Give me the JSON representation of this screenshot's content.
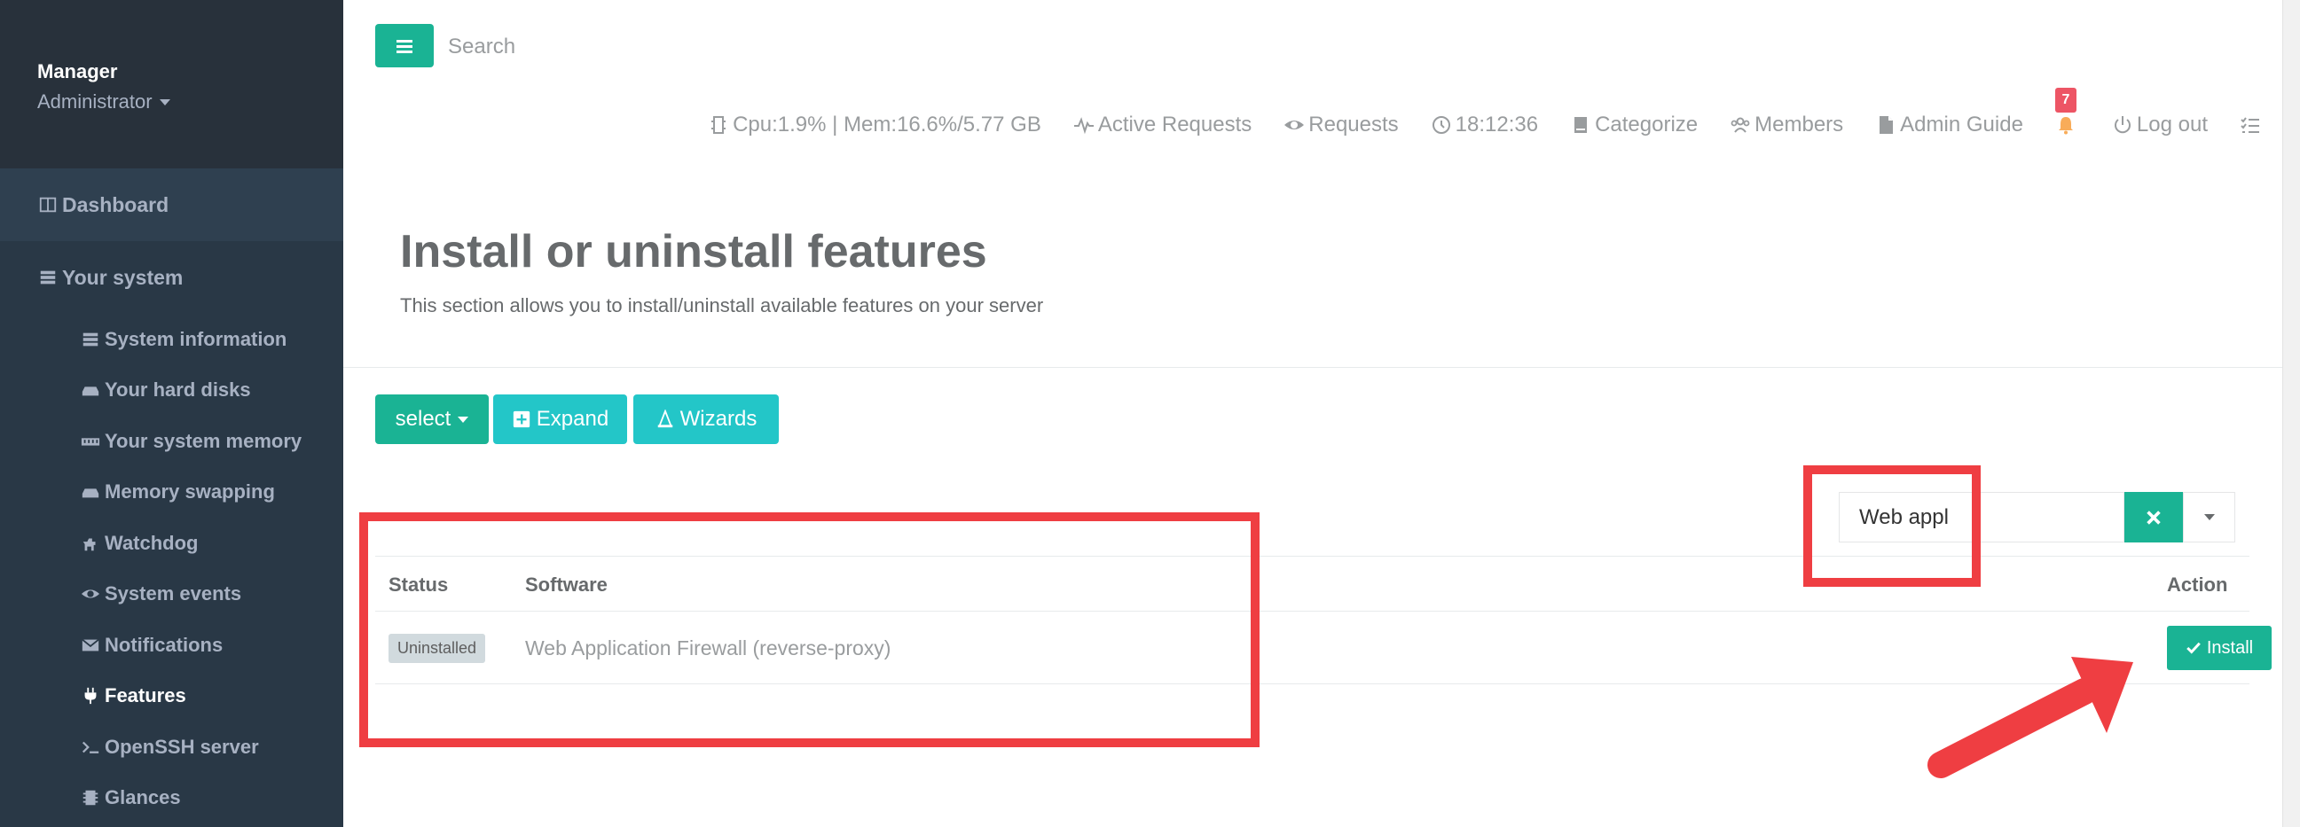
{
  "sidebar": {
    "profile": {
      "name": "Manager",
      "role": "Administrator"
    },
    "top_items": [
      {
        "label": "Dashboard",
        "icon": "columns-icon"
      },
      {
        "label": "Your system",
        "icon": "server-icon"
      }
    ],
    "sub_items": [
      {
        "label": "System information",
        "icon": "server-icon"
      },
      {
        "label": "Your hard disks",
        "icon": "hdd-icon"
      },
      {
        "label": "Your system memory",
        "icon": "memory-icon"
      },
      {
        "label": "Memory swapping",
        "icon": "hdd-icon"
      },
      {
        "label": "Watchdog",
        "icon": "dog-icon"
      },
      {
        "label": "System events",
        "icon": "eye-icon"
      },
      {
        "label": "Notifications",
        "icon": "envelope-icon"
      },
      {
        "label": "Features",
        "icon": "plug-icon"
      },
      {
        "label": "OpenSSH server",
        "icon": "terminal-icon"
      },
      {
        "label": "Glances",
        "icon": "chip-icon"
      }
    ]
  },
  "topbar": {
    "search_placeholder": "Search",
    "stats": "Cpu:1.9% | Mem:16.6%/5.77 GB",
    "active_requests": "Active Requests",
    "requests": "Requests",
    "time": "18:12:36",
    "categorize": "Categorize",
    "members": "Members",
    "admin_guide": "Admin Guide",
    "notification_count": "7",
    "logout": "Log out"
  },
  "heading": {
    "title": "Install or uninstall features",
    "subtitle": "This section allows you to install/uninstall available features on your server"
  },
  "toolbar": {
    "select_label": "select",
    "expand_label": "Expand",
    "wizards_label": "Wizards"
  },
  "filter": {
    "value": "Web appl"
  },
  "table": {
    "headers": {
      "status": "Status",
      "software": "Software",
      "action": "Action"
    },
    "rows": [
      {
        "status": "Uninstalled",
        "software": "Web Application Firewall (reverse-proxy)",
        "action": "Install"
      }
    ]
  },
  "colors": {
    "sidebar_bg": "#2f4050",
    "primary": "#1ab394",
    "info": "#23c6c8",
    "annotation": "#ef3e42",
    "badge": "#ed5565"
  }
}
